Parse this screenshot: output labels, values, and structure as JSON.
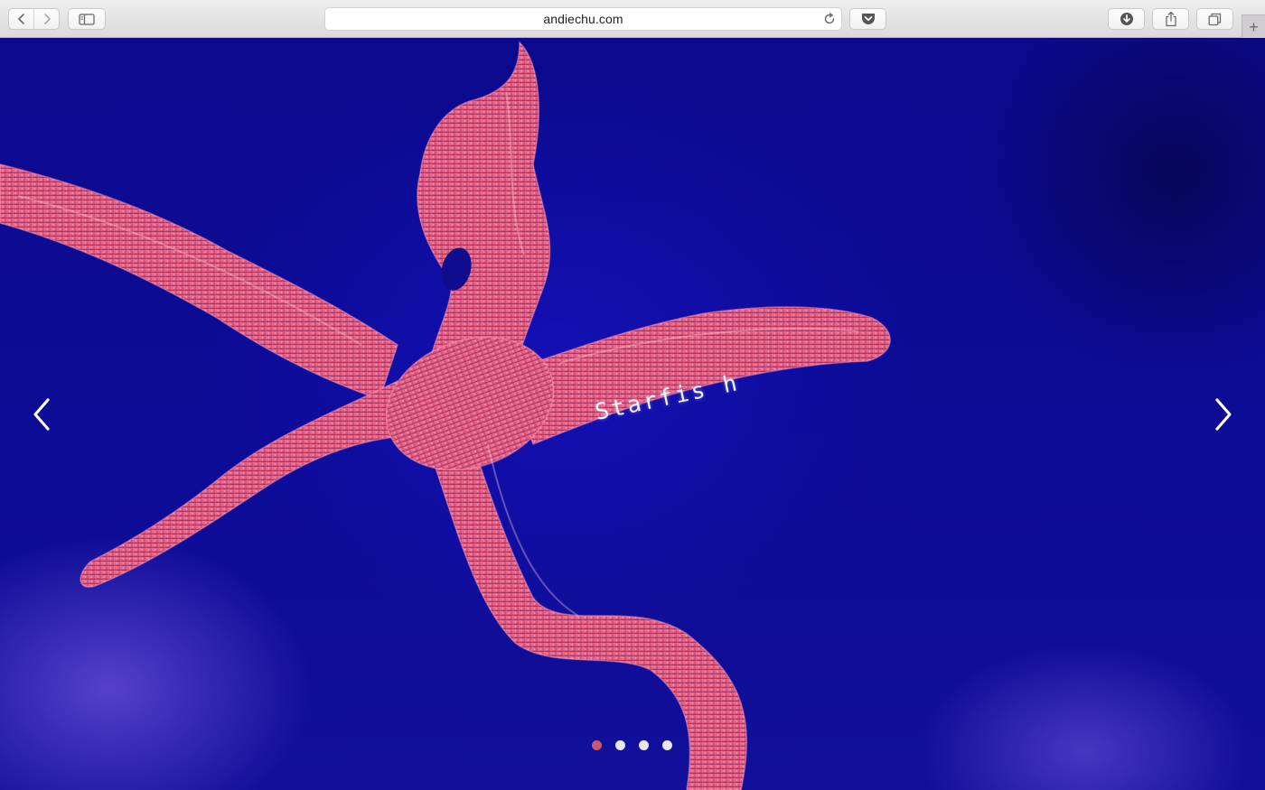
{
  "browser": {
    "url": "andiechu.com",
    "icons": {
      "back": "chevron-left-icon",
      "forward": "chevron-right-icon",
      "sidebar": "sidebar-icon",
      "reload": "reload-icon",
      "pocket": "pocket-icon",
      "downloads": "download-icon",
      "share": "share-icon",
      "tabs": "tabs-icon",
      "new_tab": "plus-icon"
    },
    "new_tab_label": "+"
  },
  "slider": {
    "caption": "Starfis h",
    "prev_icon": "chevron-left-icon",
    "next_icon": "chevron-right-icon",
    "slide_count": 4,
    "active_slide": 1
  },
  "colors": {
    "background": "#0d0c97",
    "starfish": "#e0577f",
    "active_dot": "#c9576f",
    "inactive_dot": "#e6e6f0"
  }
}
